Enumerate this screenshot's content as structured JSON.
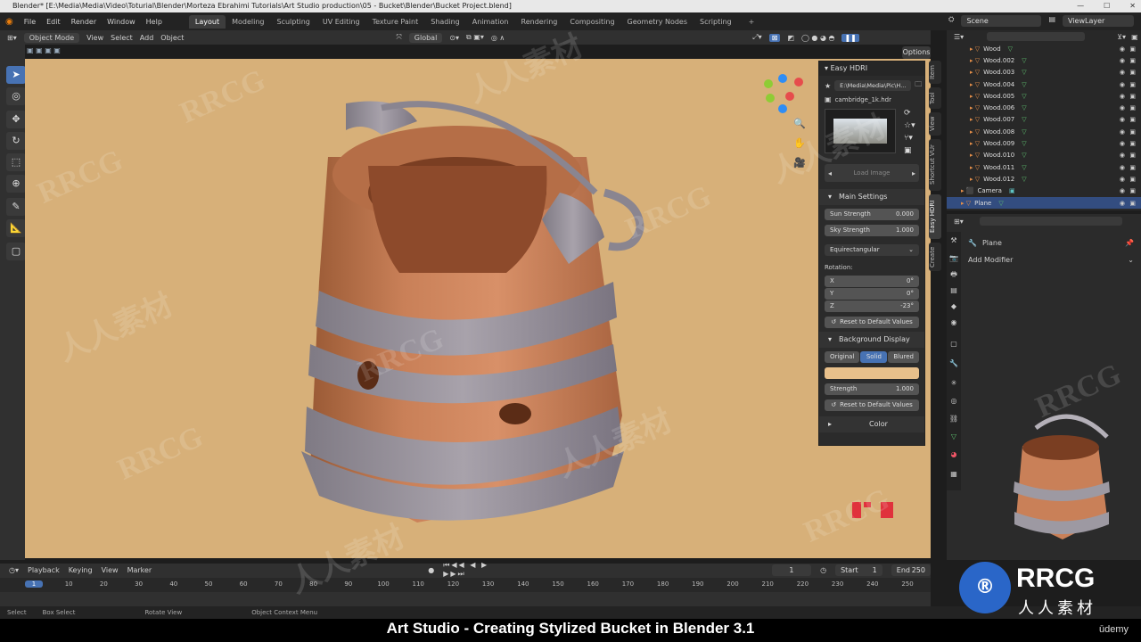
{
  "window": {
    "title": "Blender* [E:\\Media\\Media\\Video\\Toturial\\Blender\\Morteza Ebrahimi Tutorials\\Art Studio production\\05 - Bucket\\Blender\\Bucket Project.blend]"
  },
  "menu": [
    "File",
    "Edit",
    "Render",
    "Window",
    "Help"
  ],
  "workspaces": [
    "Layout",
    "Modeling",
    "Sculpting",
    "UV Editing",
    "Texture Paint",
    "Shading",
    "Animation",
    "Rendering",
    "Compositing",
    "Geometry Nodes",
    "Scripting"
  ],
  "scene": "Scene",
  "view_layer": "ViewLayer",
  "header": {
    "mode": "Object Mode",
    "view": "View",
    "select": "Select",
    "add": "Add",
    "object": "Object",
    "orientation": "Global"
  },
  "options": "Options",
  "easy_hdri": {
    "title": "Easy HDRI",
    "path": "E:\\Media\\Media\\Pic\\H...",
    "file": "cambridge_1k.hdr",
    "load": "Load Image",
    "main_settings": "Main Settings",
    "sun_strength_label": "Sun Strength",
    "sun_strength": "0.000",
    "sky_strength_label": "Sky Strength",
    "sky_strength": "1.000",
    "projection": "Equirectangular",
    "rotation": "Rotation:",
    "x_label": "X",
    "x": "0°",
    "y_label": "Y",
    "y": "0°",
    "z_label": "Z",
    "z": "-23°",
    "reset": "Reset to Default Values",
    "bg_display": "Background Display",
    "bg_modes": [
      "Original",
      "Solid",
      "Blured"
    ],
    "strength_label": "Strength",
    "strength": "1.000",
    "color": "Color",
    "bg_color": "#e8c08b"
  },
  "sidebar_tabs": [
    "Item",
    "Tool",
    "View",
    "Shortcut VUr",
    "Easy HDRI",
    "Create"
  ],
  "outliner": {
    "items": [
      "Wood",
      "Wood.002",
      "Wood.003",
      "Wood.004",
      "Wood.005",
      "Wood.006",
      "Wood.007",
      "Wood.008",
      "Wood.009",
      "Wood.010",
      "Wood.011",
      "Wood.012"
    ],
    "camera": "Camera",
    "plane": "Plane"
  },
  "properties": {
    "object": "Plane",
    "add_modifier": "Add Modifier"
  },
  "timeline": {
    "playback": "Playback",
    "keying": "Keying",
    "view": "View",
    "marker": "Marker",
    "current": "1",
    "start_label": "Start",
    "start": "1",
    "end_label": "End",
    "end": "250",
    "frames": [
      "1",
      "10",
      "20",
      "30",
      "40",
      "50",
      "60",
      "70",
      "80",
      "90",
      "100",
      "110",
      "120",
      "130",
      "140",
      "150",
      "160",
      "170",
      "180",
      "190",
      "200",
      "210",
      "220",
      "230",
      "240",
      "250"
    ]
  },
  "status": [
    "Select",
    "Box Select",
    "Rotate View",
    "Object Context Menu"
  ],
  "caption": "Art Studio - Creating Stylized Bucket in Blender 3.1",
  "udemy": "ūdemy",
  "logo": {
    "text": "RRCG",
    "sub": "人人素材"
  },
  "watermarks": [
    "RRCG",
    "人人素材"
  ]
}
